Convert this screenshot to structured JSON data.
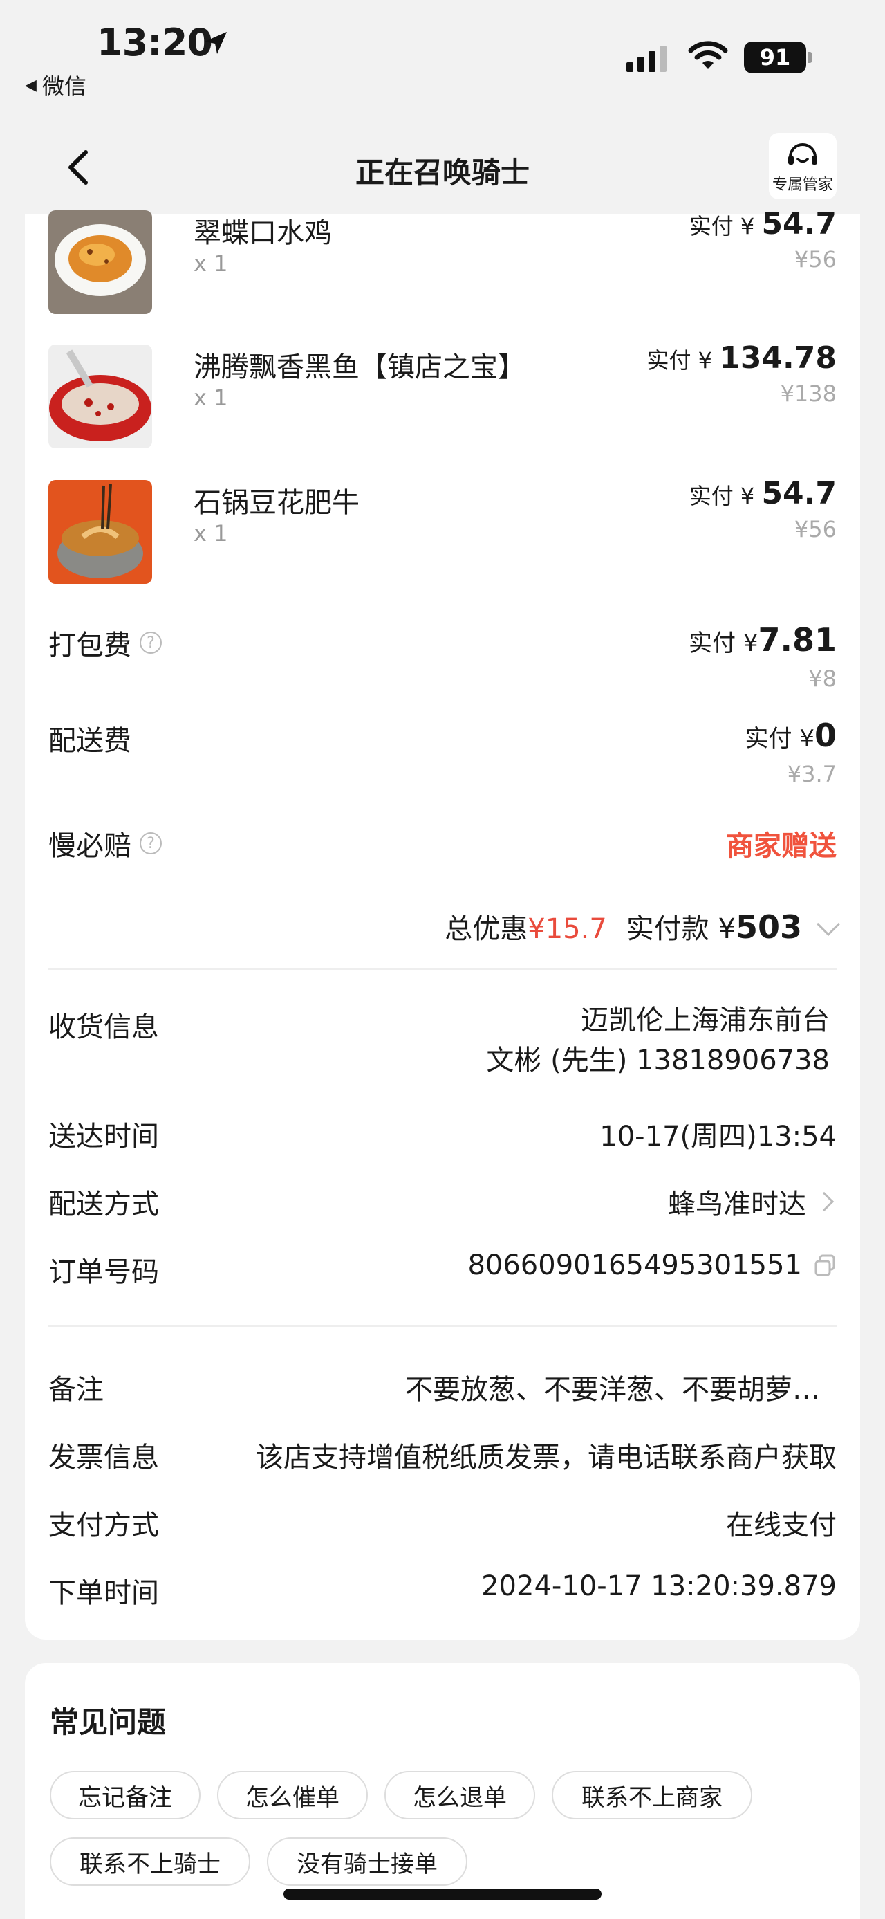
{
  "status": {
    "time": "13:20",
    "back_app": "微信",
    "battery": "91"
  },
  "nav": {
    "title": "正在召唤骑士",
    "service_label": "专属管家"
  },
  "items": [
    {
      "name": "翠蝶口水鸡",
      "qty": "x 1",
      "paid_prefix": "实付 ¥ ",
      "paid": "54.7",
      "original": "¥56"
    },
    {
      "name": "沸腾飘香黑鱼【镇店之宝】",
      "qty": "x 1",
      "paid_prefix": "实付 ¥ ",
      "paid": "134.78",
      "original": "¥138"
    },
    {
      "name": "石锅豆花肥牛",
      "qty": "x 1",
      "paid_prefix": "实付 ¥ ",
      "paid": "54.7",
      "original": "¥56"
    }
  ],
  "fees": {
    "packing": {
      "label": "打包费",
      "paid_prefix": "实付 ¥",
      "paid": "7.81",
      "original": "¥8"
    },
    "delivery": {
      "label": "配送费",
      "paid_prefix": "实付 ¥",
      "paid": "0",
      "original": "¥3.7"
    },
    "slow": {
      "label": "慢必赔",
      "value": "商家赠送"
    }
  },
  "summary": {
    "discount_label": "总优惠",
    "discount": "¥15.7",
    "paid_label": "实付款 ¥ ",
    "total": "503"
  },
  "info": {
    "receiver_label": "收货信息",
    "receiver_address": "迈凯伦上海浦东前台",
    "receiver_contact": "文彬 (先生) 13818906738",
    "arrive_label": "送达时间",
    "arrive_value": "10-17(周四)13:54",
    "method_label": "配送方式",
    "method_value": "蜂鸟准时达",
    "order_label": "订单号码",
    "order_value": "8066090165495301551"
  },
  "extra": {
    "note_label": "备注",
    "note_value": "不要放葱、不要洋葱、不要胡萝…",
    "invoice_label": "发票信息",
    "invoice_value": "该店支持增值税纸质发票，请电话联系商户获取",
    "pay_label": "支付方式",
    "pay_value": "在线支付",
    "time_label": "下单时间",
    "time_value": "2024-10-17 13:20:39.879"
  },
  "faq": {
    "title": "常见问题",
    "chips": [
      "忘记备注",
      "怎么催单",
      "怎么退单",
      "联系不上商家",
      "联系不上骑士",
      "没有骑士接单"
    ]
  }
}
